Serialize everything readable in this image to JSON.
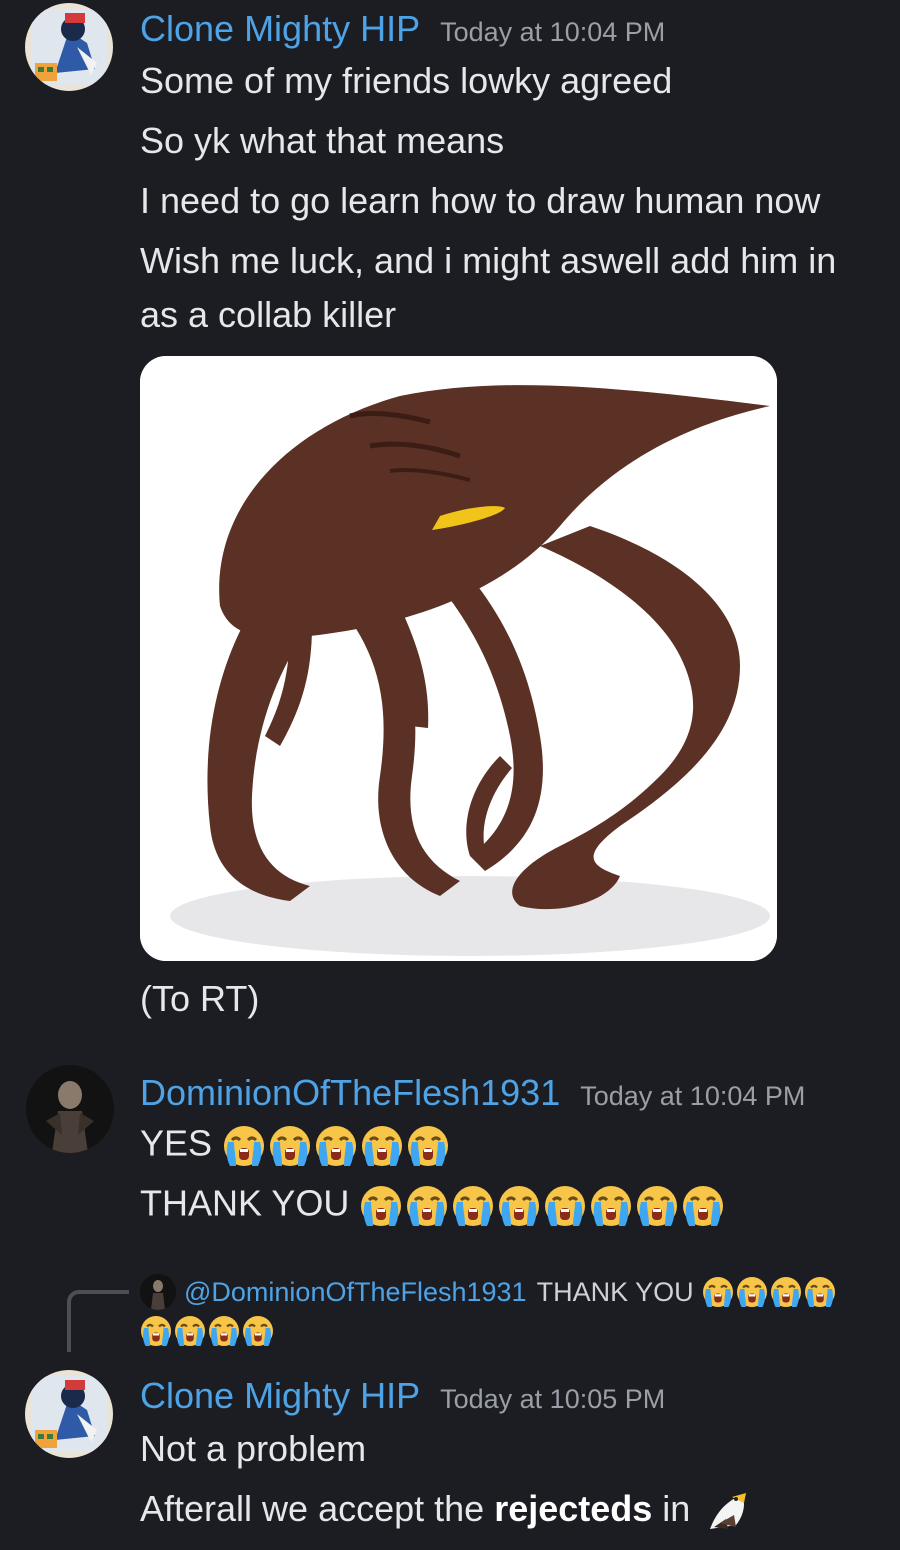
{
  "messages": [
    {
      "username": "Clone Mighty HIP",
      "timestamp": "Today at 10:04 PM",
      "lines": [
        "Some of my friends lowky agreed",
        "So yk what that means",
        "I need to go learn how to draw human now",
        "Wish me luck, and i might aswell add him in",
        "as a collab killer"
      ],
      "caption": "(To RT)"
    },
    {
      "username": "DominionOfTheFlesh1931",
      "timestamp": "Today at 10:04 PM",
      "line1": "YES",
      "line1_emoji": "loudly-crying-face",
      "line1_emoji_count": 5,
      "line2": "THANK YOU",
      "line2_emoji": "loudly-crying-face",
      "line2_emoji_count": 8
    },
    {
      "reply": {
        "mention": "@DominionOfTheFlesh1931",
        "text": "THANK YOU",
        "emoji": "loudly-crying-face",
        "emoji_count": 8
      },
      "username": "Clone Mighty HIP",
      "timestamp": "Today at 10:05 PM",
      "line1": "Not a problem",
      "line2_prefix": "Afterall we accept the ",
      "line2_bold": "rejecteds",
      "line2_suffix": " in",
      "line2_emoji": "eagle"
    }
  ],
  "colors": {
    "background": "#1c1d22",
    "username": "#4ea3e6",
    "timestamp": "#9a9ea6",
    "text": "#e6e7ea",
    "creature": "#5b3025"
  }
}
